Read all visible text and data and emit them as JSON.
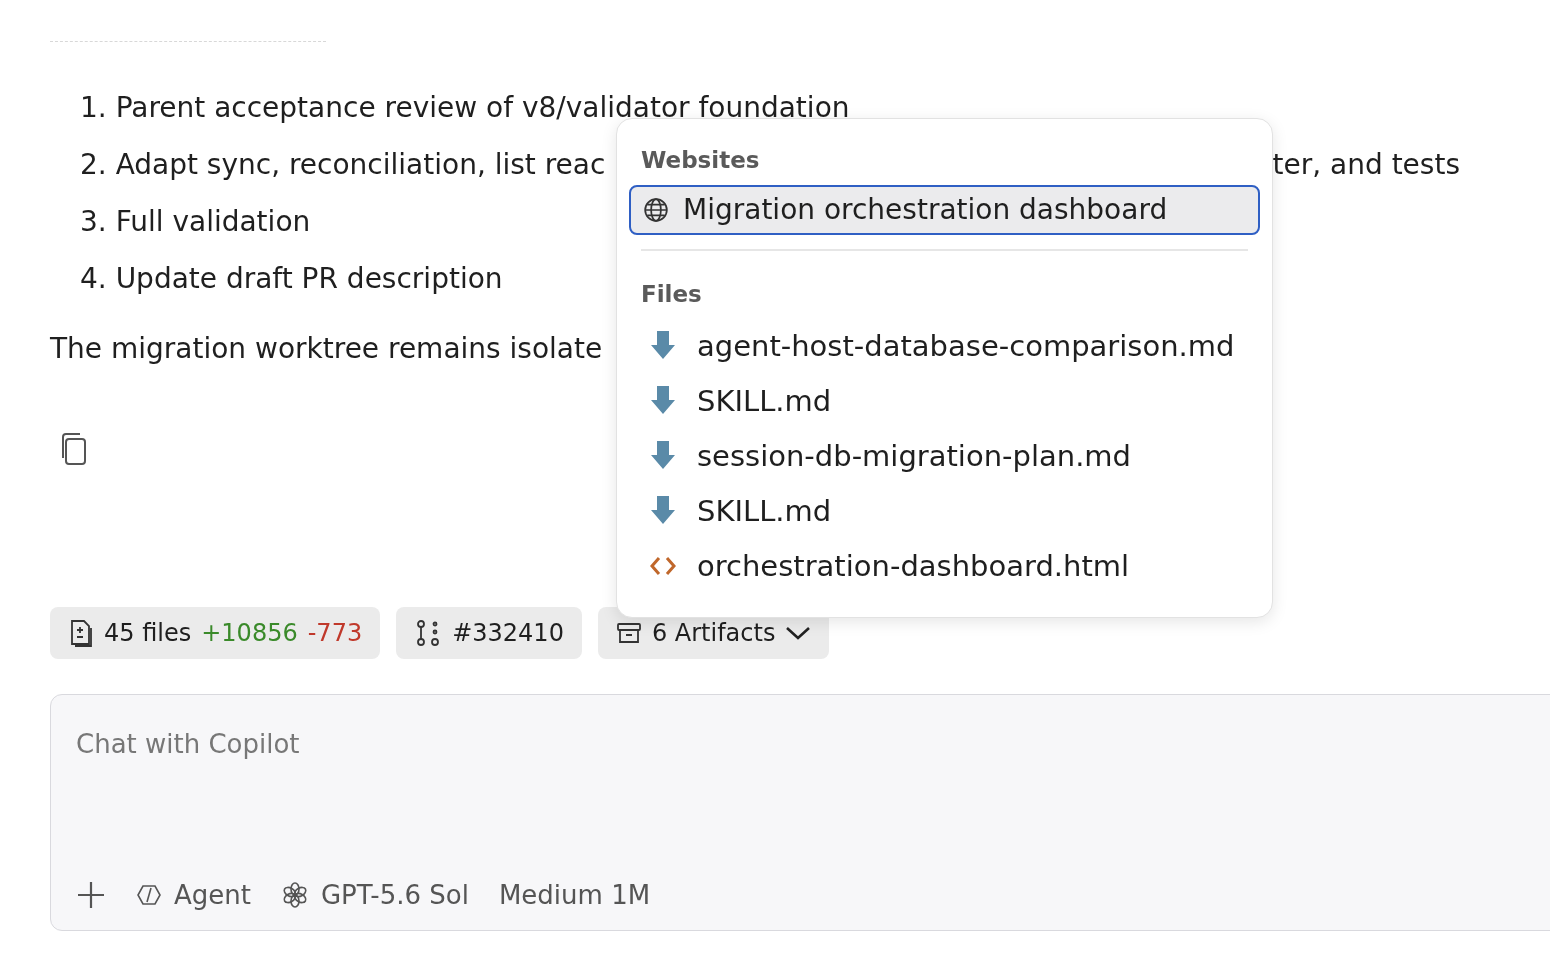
{
  "steps": [
    {
      "number": "1.",
      "text": "Parent acceptance review of v8/validator foundation"
    },
    {
      "number": "2.",
      "text": "Adapt sync, reconciliation, list reac",
      "text_after_popup": "ter, and tests"
    },
    {
      "number": "3.",
      "text": "Full validation"
    },
    {
      "number": "4.",
      "text": "Update draft PR description"
    }
  ],
  "summary": "The migration worktree remains isolate",
  "chips": [
    {
      "kind": "files",
      "label": "45 files",
      "added": "+10856",
      "removed": "-773"
    },
    {
      "kind": "pr",
      "label": "#332410"
    },
    {
      "kind": "artifacts",
      "label": "6 Artifacts"
    }
  ],
  "artifacts_popup": {
    "sections": [
      {
        "title": "Websites",
        "items": [
          {
            "kind": "website",
            "label": "Migration orchestration dashboard",
            "selected": true
          }
        ]
      },
      {
        "title": "Files",
        "items": [
          {
            "kind": "markdown",
            "label": "agent-host-database-comparison.md",
            "selected": false
          },
          {
            "kind": "markdown",
            "label": "SKILL.md",
            "selected": false
          },
          {
            "kind": "markdown",
            "label": "session-db-migration-plan.md",
            "selected": false
          },
          {
            "kind": "markdown",
            "label": "SKILL.md",
            "selected": false
          },
          {
            "kind": "html",
            "label": "orchestration-dashboard.html",
            "selected": false
          }
        ]
      }
    ]
  },
  "chat_input": {
    "placeholder": "Chat with Copilot",
    "mode": "Agent",
    "model": "GPT-5.6 Sol",
    "effort": "Medium 1M"
  }
}
